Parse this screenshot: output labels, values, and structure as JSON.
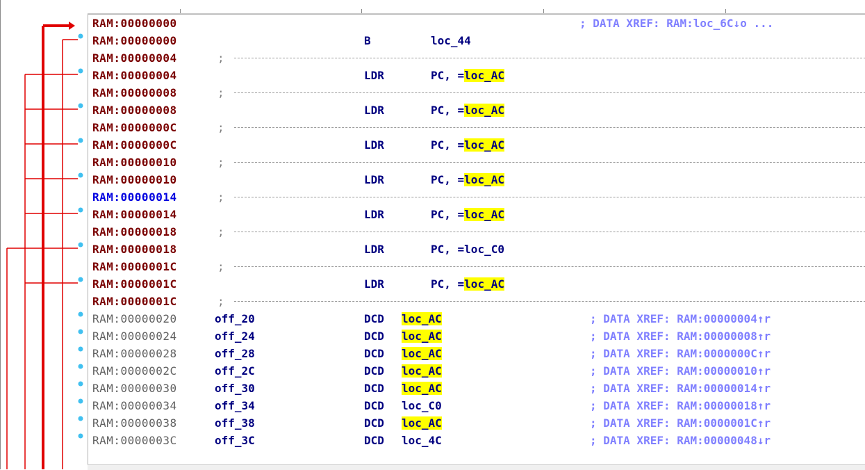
{
  "window": {
    "columns": [
      "",
      "",
      "",
      ""
    ]
  },
  "rows": [
    {
      "kind": "code",
      "addr": "RAM:00000000",
      "addr_color": "dark",
      "label": "",
      "mnemonic": "",
      "operand_prefix": "",
      "operand_target": "",
      "operand_highlight": false,
      "comment": "; DATA XREF: RAM:loc_6C↓o ...",
      "dot": false
    },
    {
      "kind": "code",
      "addr": "RAM:00000000",
      "addr_color": "dark",
      "label": "",
      "mnemonic": "B",
      "operand_prefix": "",
      "operand_target": "loc_44",
      "operand_highlight": false,
      "comment": "",
      "dot": true
    },
    {
      "kind": "sep",
      "addr": "RAM:00000004",
      "addr_color": "dark",
      "semi": ";",
      "dot": false
    },
    {
      "kind": "code",
      "addr": "RAM:00000004",
      "addr_color": "dark",
      "label": "",
      "mnemonic": "LDR",
      "operand_prefix": "PC, =",
      "operand_target": "loc_AC",
      "operand_highlight": true,
      "comment": "",
      "dot": true
    },
    {
      "kind": "sep",
      "addr": "RAM:00000008",
      "addr_color": "dark",
      "semi": ";",
      "dot": false
    },
    {
      "kind": "code",
      "addr": "RAM:00000008",
      "addr_color": "dark",
      "label": "",
      "mnemonic": "LDR",
      "operand_prefix": "PC, =",
      "operand_target": "loc_AC",
      "operand_highlight": true,
      "comment": "",
      "dot": true
    },
    {
      "kind": "sep",
      "addr": "RAM:0000000C",
      "addr_color": "dark",
      "semi": ";",
      "dot": false
    },
    {
      "kind": "code",
      "addr": "RAM:0000000C",
      "addr_color": "dark",
      "label": "",
      "mnemonic": "LDR",
      "operand_prefix": "PC, =",
      "operand_target": "loc_AC",
      "operand_highlight": true,
      "comment": "",
      "dot": true
    },
    {
      "kind": "sep",
      "addr": "RAM:00000010",
      "addr_color": "dark",
      "semi": ";",
      "dot": false
    },
    {
      "kind": "code",
      "addr": "RAM:00000010",
      "addr_color": "dark",
      "label": "",
      "mnemonic": "LDR",
      "operand_prefix": "PC, =",
      "operand_target": "loc_AC",
      "operand_highlight": true,
      "comment": "",
      "dot": true
    },
    {
      "kind": "sep",
      "addr": "RAM:00000014",
      "addr_color": "blue",
      "semi": ";",
      "dot": false
    },
    {
      "kind": "code",
      "addr": "RAM:00000014",
      "addr_color": "dark",
      "label": "",
      "mnemonic": "LDR",
      "operand_prefix": "PC, =",
      "operand_target": "loc_AC",
      "operand_highlight": true,
      "comment": "",
      "dot": true
    },
    {
      "kind": "sep",
      "addr": "RAM:00000018",
      "addr_color": "dark",
      "semi": ";",
      "dot": false
    },
    {
      "kind": "code",
      "addr": "RAM:00000018",
      "addr_color": "dark",
      "label": "",
      "mnemonic": "LDR",
      "operand_prefix": "PC, =",
      "operand_target": "loc_C0",
      "operand_highlight": false,
      "comment": "",
      "dot": true
    },
    {
      "kind": "sep",
      "addr": "RAM:0000001C",
      "addr_color": "dark",
      "semi": ";",
      "dot": false
    },
    {
      "kind": "code",
      "addr": "RAM:0000001C",
      "addr_color": "dark",
      "label": "",
      "mnemonic": "LDR",
      "operand_prefix": "PC, =",
      "operand_target": "loc_AC",
      "operand_highlight": true,
      "comment": "",
      "dot": true
    },
    {
      "kind": "sep",
      "addr": "RAM:0000001C",
      "addr_color": "dark",
      "semi": ";",
      "dot": false
    },
    {
      "kind": "data",
      "addr": "RAM:00000020",
      "addr_color": "grey",
      "label": "off_20",
      "mnemonic": "DCD",
      "operand_target": "loc_AC",
      "operand_highlight": true,
      "comment": "; DATA XREF: RAM:00000004↑r",
      "dot": true
    },
    {
      "kind": "data",
      "addr": "RAM:00000024",
      "addr_color": "grey",
      "label": "off_24",
      "mnemonic": "DCD",
      "operand_target": "loc_AC",
      "operand_highlight": true,
      "comment": "; DATA XREF: RAM:00000008↑r",
      "dot": true
    },
    {
      "kind": "data",
      "addr": "RAM:00000028",
      "addr_color": "grey",
      "label": "off_28",
      "mnemonic": "DCD",
      "operand_target": "loc_AC",
      "operand_highlight": true,
      "comment": "; DATA XREF: RAM:0000000C↑r",
      "dot": true
    },
    {
      "kind": "data",
      "addr": "RAM:0000002C",
      "addr_color": "grey",
      "label": "off_2C",
      "mnemonic": "DCD",
      "operand_target": "loc_AC",
      "operand_highlight": true,
      "comment": "; DATA XREF: RAM:00000010↑r",
      "dot": true
    },
    {
      "kind": "data",
      "addr": "RAM:00000030",
      "addr_color": "grey",
      "label": "off_30",
      "mnemonic": "DCD",
      "operand_target": "loc_AC",
      "operand_highlight": true,
      "comment": "; DATA XREF: RAM:00000014↑r",
      "dot": true
    },
    {
      "kind": "data",
      "addr": "RAM:00000034",
      "addr_color": "grey",
      "label": "off_34",
      "mnemonic": "DCD",
      "operand_target": "loc_C0",
      "operand_highlight": false,
      "comment": "; DATA XREF: RAM:00000018↑r",
      "dot": true
    },
    {
      "kind": "data",
      "addr": "RAM:00000038",
      "addr_color": "grey",
      "label": "off_38",
      "mnemonic": "DCD",
      "operand_target": "loc_AC",
      "operand_highlight": true,
      "comment": "; DATA XREF: RAM:0000001C↑r",
      "dot": true
    },
    {
      "kind": "data",
      "addr": "RAM:0000003C",
      "addr_color": "grey",
      "label": "off_3C",
      "mnemonic": "DCD",
      "operand_target": "loc_4C",
      "operand_highlight": false,
      "comment": "; DATA XREF: RAM:00000048↓r",
      "dot": true
    }
  ],
  "colors": {
    "address_dark": "#7a0000",
    "address_blue": "#0000e0",
    "address_grey": "#606060",
    "instruction": "#000080",
    "comment": "#8080ff",
    "highlight": "#ffff00",
    "flow_arrow": "#e00000",
    "breakpoint_dot": "#40c0f0"
  },
  "flow_arrows": {
    "icon": "control-flow-arrows"
  }
}
